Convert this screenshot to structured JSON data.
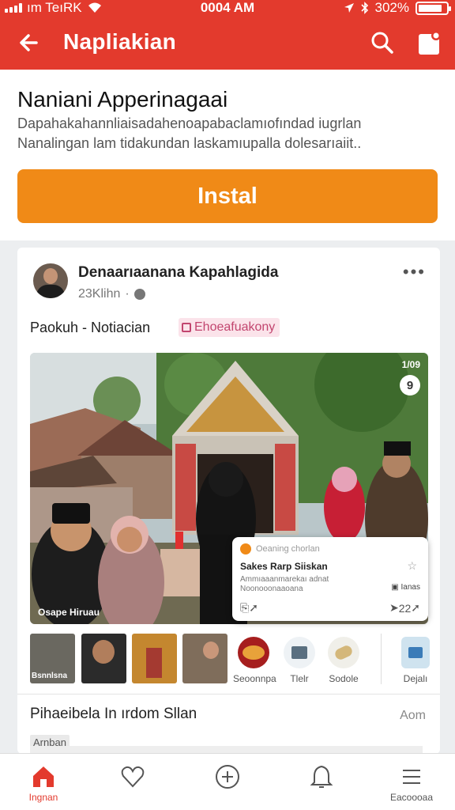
{
  "status_bar": {
    "carrier": "ım TeıRK",
    "time": "0004 AM",
    "battery": "302%",
    "battery_level": 0.85
  },
  "app_bar": {
    "title": "Napliakian",
    "back_icon": "arrow-left-icon",
    "search_icon": "search-icon",
    "share_icon": "share-icon"
  },
  "install": {
    "title": "Naniani Apperinagaai",
    "description_line1": "Dapahakahannliaisadahenoapabaclamıofındad iugrlan",
    "description_line2": "Nanalingan lam tidakundan laskamıupalla dolesarıaiit..",
    "button_label": "Instal"
  },
  "post": {
    "author": "Denaarıaanana Kapahlagida",
    "meta": "23Klihn",
    "more_icon": "more-horizontal-icon",
    "category": "Paokuh - Notiacian",
    "tag": "Ehoeafuakony",
    "media": {
      "count": "1/09",
      "badge": "9",
      "caption": "Osape Hiruau"
    },
    "popup": {
      "header": "Oeaning chorlan",
      "title": "Sakes Rarp Siiskan",
      "subtitle1": "Ammıaaanmarekaı adnat",
      "subtitle2": "Noonooonaaoana",
      "views": "Ianas",
      "count": "22"
    },
    "thumbs": [
      {
        "label": "Bsnnlsna"
      },
      {
        "label": ""
      },
      {
        "label": ""
      },
      {
        "label": ""
      }
    ],
    "apps": [
      {
        "label": "Seoonnpa"
      },
      {
        "label": "Tlelr"
      },
      {
        "label": "Sodole"
      },
      {
        "label": "Dejalı"
      }
    ],
    "related_title": "Pihaeibela In ırdom Sllan",
    "related_sub": "Aom",
    "chip": "Arnban"
  },
  "bottom_nav": [
    {
      "label": "Ingnan",
      "icon": "home-icon",
      "active": true
    },
    {
      "label": "",
      "icon": "heart-icon",
      "active": false
    },
    {
      "label": "",
      "icon": "plus-circle-icon",
      "active": false
    },
    {
      "label": "",
      "icon": "bell-icon",
      "active": false
    },
    {
      "label": "Eacoooaa",
      "icon": "menu-icon",
      "active": false
    }
  ],
  "colors": {
    "brand_red": "#e33a2d",
    "install_orange": "#f08a17",
    "tag_pink": "#c2456f"
  }
}
